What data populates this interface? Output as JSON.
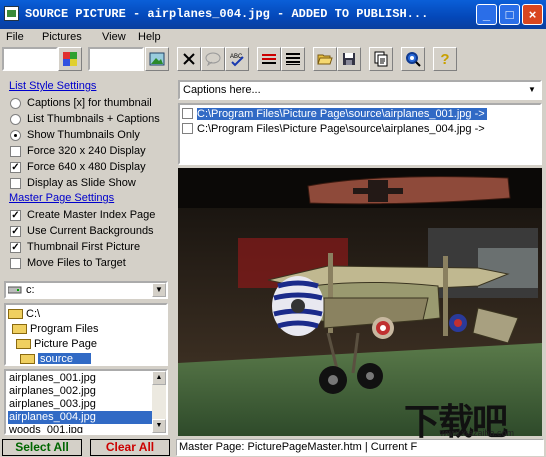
{
  "window": {
    "title": "SOURCE PICTURE - airplanes_004.jpg - ADDED TO PUBLISH..."
  },
  "menu": [
    "File",
    "Pictures",
    "View",
    "Help"
  ],
  "toolbar": {
    "icons": [
      "palette-icon",
      "picture-icon",
      "delete-icon",
      "comment-icon",
      "spellcheck-icon",
      "list-red-icon",
      "list-black-icon",
      "open-folder-icon",
      "save-icon",
      "copy-page-icon",
      "preview-icon",
      "help-icon"
    ]
  },
  "left": {
    "list_style_link": "List Style Settings",
    "list_style_options": [
      {
        "label": "Captions [x] for thumbnail",
        "selected": false
      },
      {
        "label": "List Thumbnails + Captions",
        "selected": false
      },
      {
        "label": "Show Thumbnails Only",
        "selected": true
      }
    ],
    "force_options": [
      {
        "label": "Force 320 x 240 Display",
        "checked": false
      },
      {
        "label": "Force 640 x 480 Display",
        "checked": true
      },
      {
        "label": "Display as Slide Show",
        "checked": false
      }
    ],
    "master_page_link": "Master Page Settings",
    "master_options": [
      {
        "label": "Create Master Index Page",
        "checked": true
      },
      {
        "label": "Use Current Backgrounds",
        "checked": true
      },
      {
        "label": "Thumbnail First Picture",
        "checked": true
      },
      {
        "label": "Move Files to Target",
        "checked": false
      }
    ],
    "drive": "c:",
    "folders": [
      "C:\\",
      "Program Files",
      "Picture Page",
      "source"
    ],
    "files": [
      "airplanes_001.jpg",
      "airplanes_002.jpg",
      "airplanes_003.jpg",
      "airplanes_004.jpg",
      "woods_001.jpg"
    ],
    "selected_file_index": 3,
    "select_all": "Select All",
    "clear_all": "Clear All"
  },
  "right": {
    "caption_placeholder": "Captions here...",
    "paths": [
      {
        "text": "C:\\Program Files\\Picture Page\\source\\airplanes_001.jpg ->",
        "selected": true
      },
      {
        "text": "C:\\Program Files\\Picture Page\\source\\airplanes_004.jpg ->",
        "selected": false
      }
    ],
    "status": "Master Page: PicturePageMaster.htm | Current F"
  },
  "watermark": {
    "big": "下载吧",
    "small": "www.xiazaiba.com"
  },
  "colors": {
    "title_bar": "#0a4ac0",
    "selection": "#316ac5",
    "link": "#0000cc",
    "clear_all": "#cc0000",
    "select_all": "#006600"
  }
}
